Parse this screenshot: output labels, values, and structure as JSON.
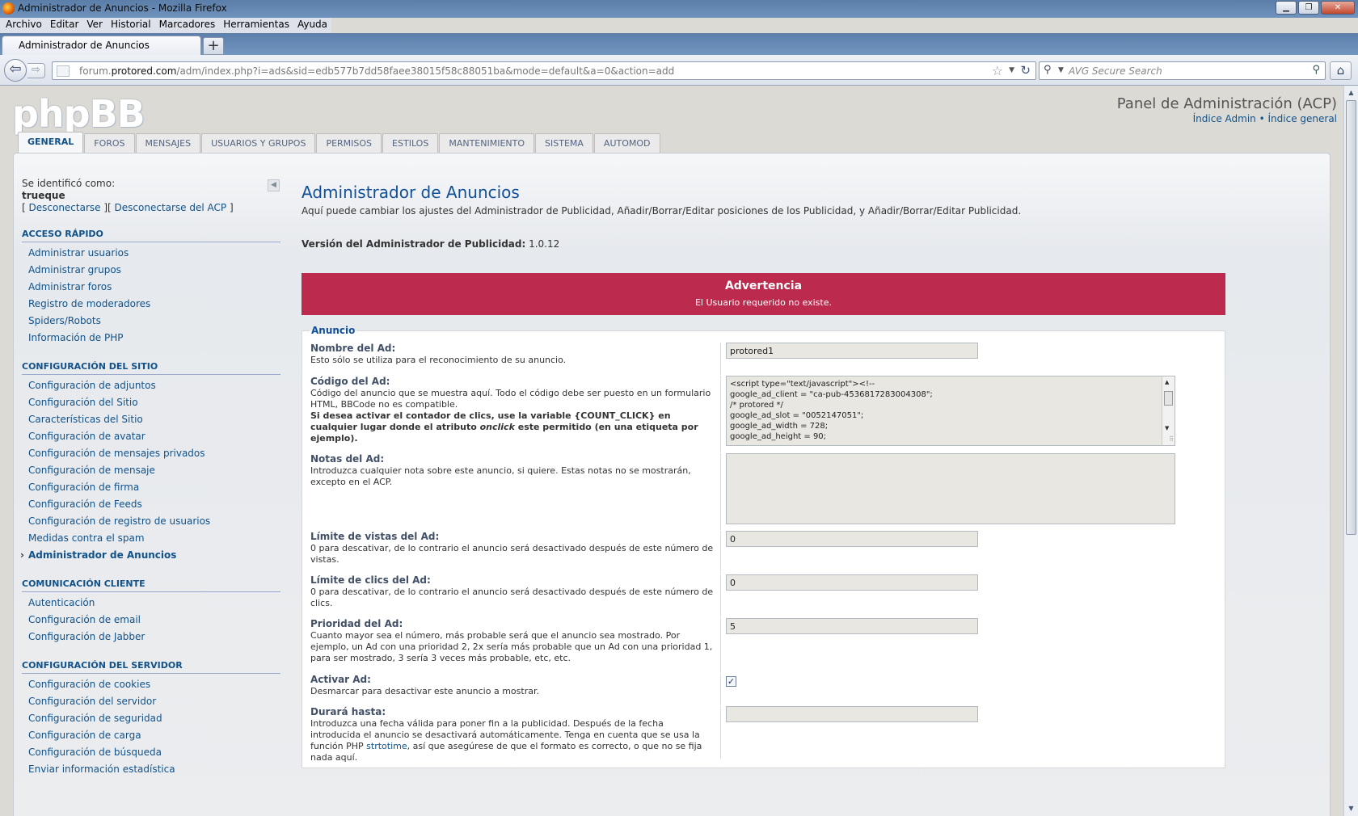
{
  "browser": {
    "window_title": "Administrador de Anuncios - Mozilla Firefox",
    "menu": [
      "Archivo",
      "Editar",
      "Ver",
      "Historial",
      "Marcadores",
      "Herramientas",
      "Ayuda"
    ],
    "tab_title": "Administrador de Anuncios",
    "url_prefix": "forum.",
    "url_domain": "protored.com",
    "url_rest": "/adm/index.php?i=ads&sid=edb577b7dd58faee38015f58c88051ba&mode=default&a=0&action=add",
    "search_placeholder": "AVG Secure Search"
  },
  "header": {
    "logo": "phpBB",
    "acp_title": "Panel de Administración (ACP)",
    "link_admin_index": "Índice Admin",
    "link_sep": "•",
    "link_general_index": "Índice general"
  },
  "tabs": [
    "GENERAL",
    "FOROS",
    "MENSAJES",
    "USUARIOS Y GRUPOS",
    "PERMISOS",
    "ESTILOS",
    "MANTENIMIENTO",
    "SISTEMA",
    "AUTOMOD"
  ],
  "sidebar": {
    "logged_as": "Se identificó como:",
    "username": "trueque",
    "logout_pre": "[ ",
    "logout": "Desconectarse",
    "logout_mid": " ][ ",
    "logout_acp": "Desconectarse del ACP",
    "logout_post": " ]",
    "sections": [
      {
        "title": "ACCESO RÁPIDO",
        "items": [
          "Administrar usuarios",
          "Administrar grupos",
          "Administrar foros",
          "Registro de moderadores",
          "Spiders/Robots",
          "Información de PHP"
        ]
      },
      {
        "title": "CONFIGURACIÓN DEL SITIO",
        "items": [
          "Configuración de adjuntos",
          "Configuración del Sitio",
          "Características del Sitio",
          "Configuración de avatar",
          "Configuración de mensajes privados",
          "Configuración de mensaje",
          "Configuración de firma",
          "Configuración de Feeds",
          "Configuración de registro de usuarios",
          "Medidas contra el spam",
          "Administrador de Anuncios"
        ]
      },
      {
        "title": "COMUNICACIÓN CLIENTE",
        "items": [
          "Autenticación",
          "Configuración de email",
          "Configuración de Jabber"
        ]
      },
      {
        "title": "CONFIGURACIÓN DEL SERVIDOR",
        "items": [
          "Configuración de cookies",
          "Configuración del servidor",
          "Configuración de seguridad",
          "Configuración de carga",
          "Configuración de búsqueda",
          "Enviar información estadística"
        ]
      }
    ]
  },
  "main": {
    "title": "Administrador de Anuncios",
    "intro": "Aquí puede cambiar los ajustes del Administrador de Publicidad, Añadir/Borrar/Editar posiciones de los Publicidad, y Añadir/Borrar/Editar Publicidad.",
    "version_label": "Versión del Administrador de Publicidad:",
    "version_value": "1.0.12",
    "warning_title": "Advertencia",
    "warning_msg": "El Usuario requerido no existe.",
    "legend": "Anuncio",
    "fields": {
      "name_label": "Nombre del Ad:",
      "name_desc": "Esto sólo se utiliza para el reconocimiento de su anuncio.",
      "name_value": "protored1",
      "code_label": "Código del Ad:",
      "code_desc": "Código del anuncio que se muestra aquí. Todo el código debe ser puesto en un formulario HTML, BBCode no es compatible.",
      "code_desc_bold1": "Si desea activar el contador de clics, use la variable {COUNT_CLICK} en cualquier lugar donde el atributo ",
      "code_desc_italic": "onclick",
      "code_desc_bold2": " este permitido (en una etiqueta por ejemplo).",
      "code_value": "<script type=\"text/javascript\"><!--\ngoogle_ad_client = \"ca-pub-4536817283004308\";\n/* protored */\ngoogle_ad_slot = \"0052147051\";\ngoogle_ad_width = 728;\ngoogle_ad_height = 90;",
      "notes_label": "Notas del Ad:",
      "notes_desc": "Introduzca cualquier nota sobre este anuncio, si quiere. Estas notas no se mostrarán, excepto en el ACP.",
      "notes_value": "",
      "views_label": "Límite de vistas del Ad:",
      "views_desc": "0 para descativar, de lo contrario el anuncio será desactivado después de este número de vistas.",
      "views_value": "0",
      "clicks_label": "Límite de clics del Ad:",
      "clicks_desc": "0 para descativar, de lo contrario el anuncio será desactivado después de este número de clics.",
      "clicks_value": "0",
      "priority_label": "Prioridad del Ad:",
      "priority_desc": "Cuanto mayor sea el número, más probable será que el anuncio sea mostrado. Por ejemplo, un Ad con una prioridad 2, 2x sería más probable que un Ad con una prioridad 1, para ser mostrado, 3 sería 3 veces más probable, etc, etc.",
      "priority_value": "5",
      "active_label": "Activar Ad:",
      "active_desc": "Desmarcar para desactivar este anuncio a mostrar.",
      "active_check": "✓",
      "until_label": "Durará hasta:",
      "until_desc_1": "Introduzca una fecha válida para poner fin a la publicidad. Después de la fecha introducida el anuncio se desactivará automáticamente. Tenga en cuenta que se usa la función PHP ",
      "until_desc_link": "strtotime",
      "until_desc_2": ", así que asegúrese de que el formato es correcto, o que no se fija nada aquí.",
      "until_value": ""
    }
  }
}
